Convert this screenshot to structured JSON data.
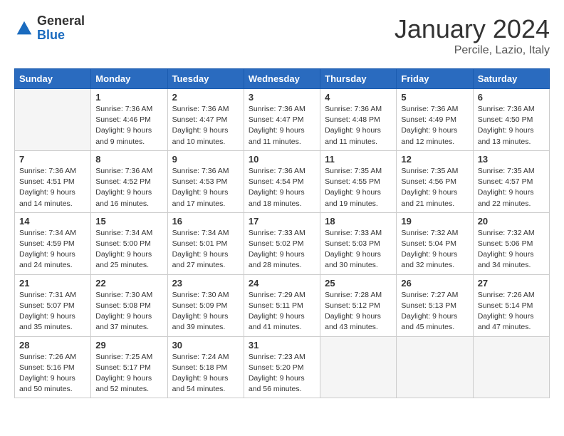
{
  "header": {
    "logo": {
      "general": "General",
      "blue": "Blue"
    },
    "title": "January 2024",
    "location": "Percile, Lazio, Italy"
  },
  "weekdays": [
    "Sunday",
    "Monday",
    "Tuesday",
    "Wednesday",
    "Thursday",
    "Friday",
    "Saturday"
  ],
  "weeks": [
    [
      {
        "day": "",
        "empty": true
      },
      {
        "day": "1",
        "sunrise": "Sunrise: 7:36 AM",
        "sunset": "Sunset: 4:46 PM",
        "daylight": "Daylight: 9 hours and 9 minutes."
      },
      {
        "day": "2",
        "sunrise": "Sunrise: 7:36 AM",
        "sunset": "Sunset: 4:47 PM",
        "daylight": "Daylight: 9 hours and 10 minutes."
      },
      {
        "day": "3",
        "sunrise": "Sunrise: 7:36 AM",
        "sunset": "Sunset: 4:47 PM",
        "daylight": "Daylight: 9 hours and 11 minutes."
      },
      {
        "day": "4",
        "sunrise": "Sunrise: 7:36 AM",
        "sunset": "Sunset: 4:48 PM",
        "daylight": "Daylight: 9 hours and 11 minutes."
      },
      {
        "day": "5",
        "sunrise": "Sunrise: 7:36 AM",
        "sunset": "Sunset: 4:49 PM",
        "daylight": "Daylight: 9 hours and 12 minutes."
      },
      {
        "day": "6",
        "sunrise": "Sunrise: 7:36 AM",
        "sunset": "Sunset: 4:50 PM",
        "daylight": "Daylight: 9 hours and 13 minutes."
      }
    ],
    [
      {
        "day": "7",
        "sunrise": "Sunrise: 7:36 AM",
        "sunset": "Sunset: 4:51 PM",
        "daylight": "Daylight: 9 hours and 14 minutes."
      },
      {
        "day": "8",
        "sunrise": "Sunrise: 7:36 AM",
        "sunset": "Sunset: 4:52 PM",
        "daylight": "Daylight: 9 hours and 16 minutes."
      },
      {
        "day": "9",
        "sunrise": "Sunrise: 7:36 AM",
        "sunset": "Sunset: 4:53 PM",
        "daylight": "Daylight: 9 hours and 17 minutes."
      },
      {
        "day": "10",
        "sunrise": "Sunrise: 7:36 AM",
        "sunset": "Sunset: 4:54 PM",
        "daylight": "Daylight: 9 hours and 18 minutes."
      },
      {
        "day": "11",
        "sunrise": "Sunrise: 7:35 AM",
        "sunset": "Sunset: 4:55 PM",
        "daylight": "Daylight: 9 hours and 19 minutes."
      },
      {
        "day": "12",
        "sunrise": "Sunrise: 7:35 AM",
        "sunset": "Sunset: 4:56 PM",
        "daylight": "Daylight: 9 hours and 21 minutes."
      },
      {
        "day": "13",
        "sunrise": "Sunrise: 7:35 AM",
        "sunset": "Sunset: 4:57 PM",
        "daylight": "Daylight: 9 hours and 22 minutes."
      }
    ],
    [
      {
        "day": "14",
        "sunrise": "Sunrise: 7:34 AM",
        "sunset": "Sunset: 4:59 PM",
        "daylight": "Daylight: 9 hours and 24 minutes."
      },
      {
        "day": "15",
        "sunrise": "Sunrise: 7:34 AM",
        "sunset": "Sunset: 5:00 PM",
        "daylight": "Daylight: 9 hours and 25 minutes."
      },
      {
        "day": "16",
        "sunrise": "Sunrise: 7:34 AM",
        "sunset": "Sunset: 5:01 PM",
        "daylight": "Daylight: 9 hours and 27 minutes."
      },
      {
        "day": "17",
        "sunrise": "Sunrise: 7:33 AM",
        "sunset": "Sunset: 5:02 PM",
        "daylight": "Daylight: 9 hours and 28 minutes."
      },
      {
        "day": "18",
        "sunrise": "Sunrise: 7:33 AM",
        "sunset": "Sunset: 5:03 PM",
        "daylight": "Daylight: 9 hours and 30 minutes."
      },
      {
        "day": "19",
        "sunrise": "Sunrise: 7:32 AM",
        "sunset": "Sunset: 5:04 PM",
        "daylight": "Daylight: 9 hours and 32 minutes."
      },
      {
        "day": "20",
        "sunrise": "Sunrise: 7:32 AM",
        "sunset": "Sunset: 5:06 PM",
        "daylight": "Daylight: 9 hours and 34 minutes."
      }
    ],
    [
      {
        "day": "21",
        "sunrise": "Sunrise: 7:31 AM",
        "sunset": "Sunset: 5:07 PM",
        "daylight": "Daylight: 9 hours and 35 minutes."
      },
      {
        "day": "22",
        "sunrise": "Sunrise: 7:30 AM",
        "sunset": "Sunset: 5:08 PM",
        "daylight": "Daylight: 9 hours and 37 minutes."
      },
      {
        "day": "23",
        "sunrise": "Sunrise: 7:30 AM",
        "sunset": "Sunset: 5:09 PM",
        "daylight": "Daylight: 9 hours and 39 minutes."
      },
      {
        "day": "24",
        "sunrise": "Sunrise: 7:29 AM",
        "sunset": "Sunset: 5:11 PM",
        "daylight": "Daylight: 9 hours and 41 minutes."
      },
      {
        "day": "25",
        "sunrise": "Sunrise: 7:28 AM",
        "sunset": "Sunset: 5:12 PM",
        "daylight": "Daylight: 9 hours and 43 minutes."
      },
      {
        "day": "26",
        "sunrise": "Sunrise: 7:27 AM",
        "sunset": "Sunset: 5:13 PM",
        "daylight": "Daylight: 9 hours and 45 minutes."
      },
      {
        "day": "27",
        "sunrise": "Sunrise: 7:26 AM",
        "sunset": "Sunset: 5:14 PM",
        "daylight": "Daylight: 9 hours and 47 minutes."
      }
    ],
    [
      {
        "day": "28",
        "sunrise": "Sunrise: 7:26 AM",
        "sunset": "Sunset: 5:16 PM",
        "daylight": "Daylight: 9 hours and 50 minutes."
      },
      {
        "day": "29",
        "sunrise": "Sunrise: 7:25 AM",
        "sunset": "Sunset: 5:17 PM",
        "daylight": "Daylight: 9 hours and 52 minutes."
      },
      {
        "day": "30",
        "sunrise": "Sunrise: 7:24 AM",
        "sunset": "Sunset: 5:18 PM",
        "daylight": "Daylight: 9 hours and 54 minutes."
      },
      {
        "day": "31",
        "sunrise": "Sunrise: 7:23 AM",
        "sunset": "Sunset: 5:20 PM",
        "daylight": "Daylight: 9 hours and 56 minutes."
      },
      {
        "day": "",
        "empty": true
      },
      {
        "day": "",
        "empty": true
      },
      {
        "day": "",
        "empty": true
      }
    ]
  ]
}
